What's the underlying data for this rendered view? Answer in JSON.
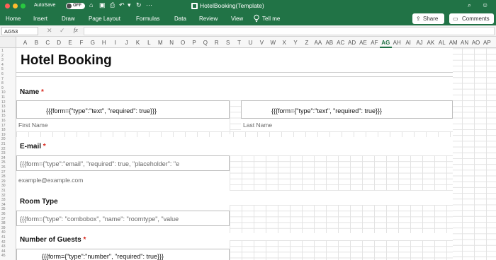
{
  "titlebar": {
    "autosave_label": "AutoSave",
    "toggle_label": "OFF",
    "doc_title": "HotelBooking(Template)"
  },
  "ribbon": {
    "tabs": [
      "Home",
      "Insert",
      "Draw",
      "Page Layout",
      "Formulas",
      "Data",
      "Review",
      "View"
    ],
    "tell_me": "Tell me",
    "share_label": "Share",
    "comments_label": "Comments"
  },
  "formula_bar": {
    "name_box": "AG53",
    "fx_label": "fx",
    "value": ""
  },
  "grid": {
    "columns": [
      "A",
      "B",
      "C",
      "D",
      "E",
      "F",
      "G",
      "H",
      "I",
      "J",
      "K",
      "L",
      "M",
      "N",
      "O",
      "P",
      "Q",
      "R",
      "S",
      "T",
      "U",
      "V",
      "W",
      "X",
      "Y",
      "Z",
      "AA",
      "AB",
      "AC",
      "AD",
      "AE",
      "AF",
      "AG",
      "AH",
      "AI",
      "AJ",
      "AK",
      "AL",
      "AM",
      "AN",
      "AO",
      "AP"
    ],
    "active_column": "AG",
    "rows": [
      "1",
      "2",
      "3",
      "4",
      "5",
      "6",
      "7",
      "8",
      "9",
      "10",
      "11",
      "12",
      "13",
      "14",
      "15",
      "16",
      "17",
      "18",
      "19",
      "20",
      "21",
      "22",
      "23",
      "24",
      "25",
      "26",
      "27",
      "28",
      "29",
      "30",
      "31",
      "32",
      "33",
      "34",
      "35",
      "36",
      "37",
      "38",
      "39",
      "40",
      "41",
      "42",
      "43",
      "44",
      "45"
    ]
  },
  "form": {
    "title": "Hotel Booking",
    "name_label": "Name",
    "name_first_tag": "{{{form={\"type\":\"text\", \"required\": true}}}",
    "name_last_tag": "{{{form={\"type\":\"text\", \"required\": true}}}",
    "first_name_label": "First Name",
    "last_name_label": "Last Name",
    "email_label": "E-mail",
    "email_tag": "{{{form={\"type\":\"email\", \"required\": true, \"placeholder\": \"e",
    "email_placeholder": "example@example.com",
    "room_type_label": "Room Type",
    "room_type_tag": "{{{form={\"type\": \"combobox\", \"name\": \"roomtype\", \"value",
    "guests_label": "Number of Guests",
    "guests_tag": "{{{form={\"type\":\"number\", \"required\": true}}}",
    "required_mark": "*"
  },
  "colors": {
    "excel_green": "#217346",
    "required_red": "#d9261c"
  }
}
